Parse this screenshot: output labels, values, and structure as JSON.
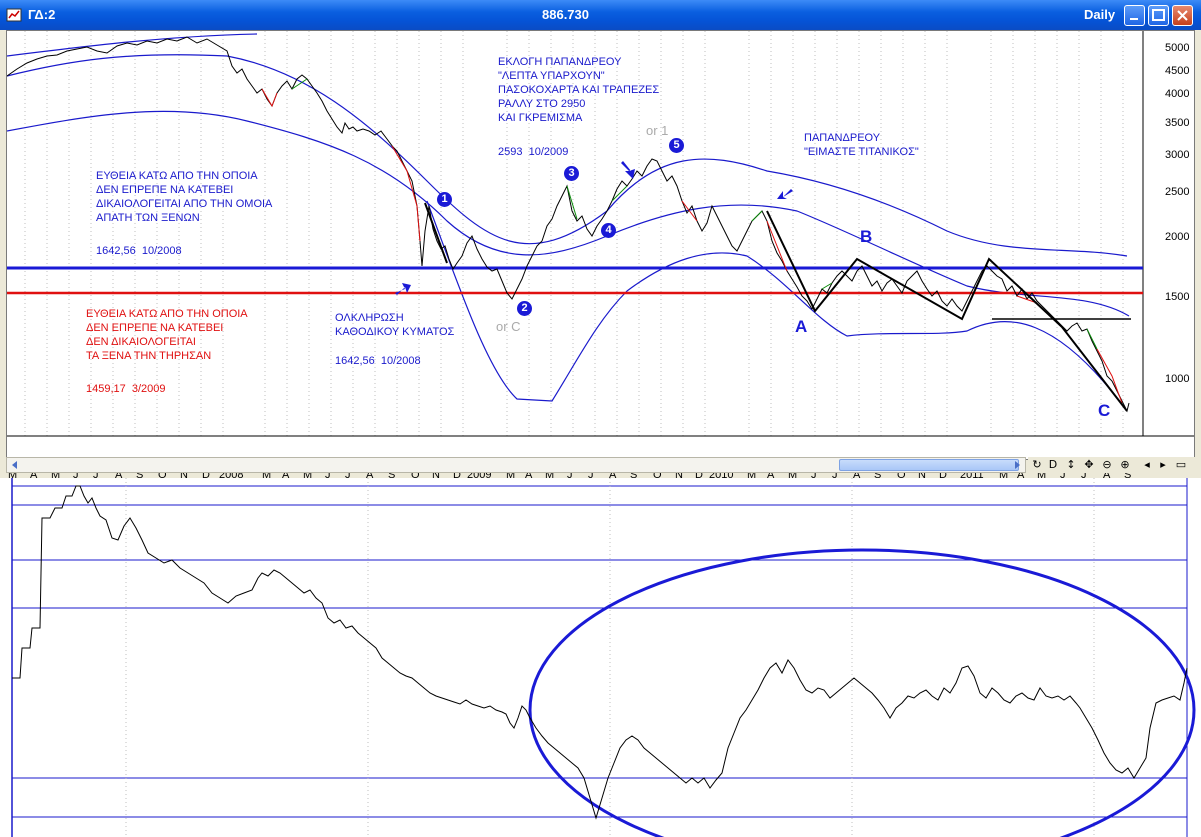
{
  "window": {
    "title": "ΓΔ:2",
    "value": "886.730",
    "period": "Daily"
  },
  "colors": {
    "titlebar": "#0553d6",
    "price_line": "#000000",
    "blue_line": "#1a1acc",
    "red_line": "#e01010",
    "green_wave": "#0a8a0a"
  },
  "icons": [
    "app-icon",
    "minimize-icon",
    "maximize-icon",
    "close-icon",
    "scroll-left-icon",
    "scroll-right-icon"
  ],
  "y_axis": [
    "5000",
    "4500",
    "4000",
    "3500",
    "3000",
    "2500",
    "2000",
    "1500",
    "1000"
  ],
  "x_axis": [
    "M",
    "A",
    "M",
    "J",
    "J",
    "A",
    "S",
    "O",
    "N",
    "D",
    "2008",
    "M",
    "A",
    "M",
    "J",
    "J",
    "A",
    "S",
    "O",
    "N",
    "D",
    "2009",
    "M",
    "A",
    "M",
    "J",
    "J",
    "A",
    "S",
    "O",
    "N",
    "D",
    "2010",
    "M",
    "A",
    "M",
    "J",
    "J",
    "A",
    "S",
    "O",
    "N",
    "D",
    "2011",
    "M",
    "A",
    "M",
    "J",
    "J",
    "A",
    "S"
  ],
  "annotations": {
    "papandreou_election": "ΕΚΛΟΓΗ ΠΑΠΑΝΔΡΕΟΥ\n\"ΛΕΠΤΑ ΥΠΑΡΧΟΥΝ\"\nΠΑΣΟΚΟΧΑΡΤΑ ΚΑΙ ΤΡΑΠΕΖΕΣ\nΡΑΛΛΥ ΣΤΟ 2950\nΚΑΙ ΓΚΡΕΜΙΣΜΑ",
    "papandreou_date": "2593  10/2009",
    "titanic": "ΠΑΠΑΝΔΡΕΟΥ\n\"ΕΙΜΑΣΤΕ ΤΙΤΑΝΙΚΟΣ\"",
    "blue_line_text": "ΕΥΘΕΙΑ ΚΑΤΩ ΑΠΟ ΤΗΝ ΟΠΟΙΑ\nΔΕΝ ΕΠΡΕΠΕ ΝΑ ΚΑΤΕΒΕΙ\nΔΙΚΑΙΟΛΟΓΕΙΤΑΙ ΑΠΟ ΤΗΝ ΟΜΟΙΑ\nΑΠΑΤΗ ΤΩΝ ΞΕΝΩΝ",
    "blue_line_value": "1642,56  10/2008",
    "red_line_text": "ΕΥΘΕΙΑ ΚΑΤΩ ΑΠΟ ΤΗΝ ΟΠΟΙΑ\nΔΕΝ ΕΠΡΕΠΕ ΝΑ ΚΑΤΕΒΕΙ\nΔΕΝ ΔΙΚΑΙΟΛΟΓΕΙΤΑΙ\nΤΑ ΞΕΝΑ ΤΗΝ ΤΗΡΗΣΑΝ",
    "red_line_value": "1459,17  3/2009",
    "completion": "ΟΛΚΛΗΡΩΣΗ\nΚΑΘΟΔΙΚΟΥ ΚΥΜΑΤΟΣ",
    "completion_value": "1642,56  10/2008"
  },
  "wave_labels": {
    "circle_1": "1",
    "circle_2": "2",
    "circle_3": "3",
    "circle_4": "4",
    "circle_5": "5",
    "big_A": "A",
    "big_B": "B",
    "big_C": "C",
    "or_1": "or 1",
    "or_c": "or C"
  },
  "toolbar": {
    "btn_d": "D"
  }
}
